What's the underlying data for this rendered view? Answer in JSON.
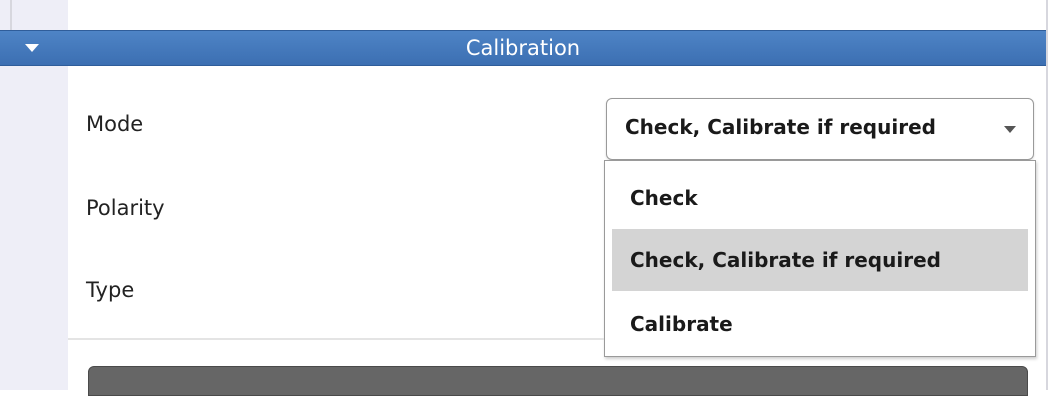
{
  "section": {
    "title": "Calibration",
    "header_color": "#4a7fc1"
  },
  "fields": {
    "mode_label": "Mode",
    "polarity_label": "Polarity",
    "type_label": "Type"
  },
  "mode_combo": {
    "selected": "Check, Calibrate if required",
    "options": [
      "Check",
      "Check, Calibrate if required",
      "Calibrate"
    ],
    "highlighted_option": "Check, Calibrate if required"
  },
  "icons": {
    "collapse": "triangle-down-icon",
    "dropdown": "chevron-down-icon"
  }
}
